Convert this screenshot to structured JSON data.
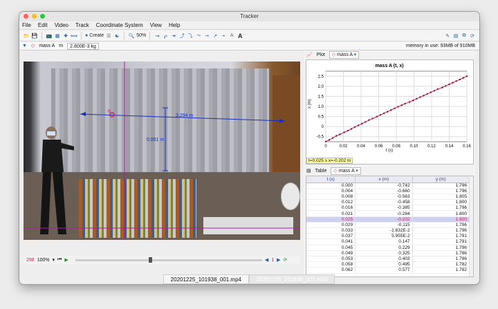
{
  "window": {
    "title": "Tracker"
  },
  "menu": [
    "File",
    "Edit",
    "Video",
    "Track",
    "Coordinate System",
    "View",
    "Help"
  ],
  "toolbar": {
    "create_label": "Create",
    "zoom_label": "50%",
    "font_label": "A"
  },
  "track_info": {
    "track_name": "mass A",
    "mass_label": "m",
    "mass_value": "2.800E-3 kg",
    "memory_label": "memory in use: 93MB of 910MB"
  },
  "video": {
    "distance_label": "3.294 m",
    "height_label": "0.951 m",
    "point_label": "6"
  },
  "player": {
    "frame": "298",
    "zoom": "100%"
  },
  "plot": {
    "tab_label": "Plot",
    "track_select": "mass A",
    "title": "mass A (t, x)",
    "xlabel": "t (s)",
    "ylabel": "x (m)",
    "readout": "t=0.025 s  x=-0.202 m",
    "x_ticks": [
      "0",
      "0.02",
      "0.04",
      "0.06",
      "0.08",
      "0.10",
      "0.12",
      "0.14",
      "0.16"
    ],
    "y_ticks": [
      "2.5",
      "2.0",
      "1.5",
      "1.0",
      "0.5",
      "0",
      "-0.5"
    ]
  },
  "chart_data": {
    "type": "line",
    "title": "mass A (t, x)",
    "xlabel": "t (s)",
    "ylabel": "x (m)",
    "xlim": [
      0,
      0.16
    ],
    "ylim": [
      -0.75,
      2.75
    ],
    "x": [
      0.0,
      0.004,
      0.008,
      0.012,
      0.016,
      0.021,
      0.025,
      0.029,
      0.033,
      0.037,
      0.041,
      0.045,
      0.049,
      0.053,
      0.058,
      0.062,
      0.066,
      0.07,
      0.074,
      0.078,
      0.082,
      0.086,
      0.09,
      0.095,
      0.099,
      0.103,
      0.107,
      0.111,
      0.115,
      0.119,
      0.123,
      0.127,
      0.132,
      0.136,
      0.14,
      0.144,
      0.148,
      0.152,
      0.156,
      0.16
    ],
    "y": [
      -0.742,
      -0.66,
      -0.563,
      -0.458,
      -0.385,
      -0.284,
      -0.202,
      -0.115,
      -0.018,
      0.06,
      0.147,
      0.229,
      0.325,
      0.403,
      0.495,
      0.577,
      0.66,
      0.74,
      0.82,
      0.905,
      0.985,
      1.06,
      1.14,
      1.22,
      1.3,
      1.385,
      1.46,
      1.54,
      1.62,
      1.7,
      1.78,
      1.86,
      1.94,
      2.02,
      2.1,
      2.18,
      2.26,
      2.34,
      2.42,
      2.5
    ]
  },
  "table": {
    "tab_label": "Table",
    "track_select": "mass A",
    "columns": [
      "t (s)",
      "x (m)",
      "y (m)"
    ],
    "rows": [
      [
        "0.000",
        "-0.742",
        "1.796"
      ],
      [
        "0.004",
        "-0.660",
        "1.796"
      ],
      [
        "0.008",
        "-0.563",
        "1.805"
      ],
      [
        "0.012",
        "-0.458",
        "1.800"
      ],
      [
        "0.016",
        "-0.385",
        "1.796"
      ],
      [
        "0.021",
        "-0.284",
        "1.800"
      ],
      [
        "0.025",
        "-0.202",
        "1.800"
      ],
      [
        "0.029",
        "-0.115",
        "1.796"
      ],
      [
        "0.033",
        "-1.832E-2",
        "1.796"
      ],
      [
        "0.037",
        "5.955E-2",
        "1.791"
      ],
      [
        "0.041",
        "0.147",
        "1.791"
      ],
      [
        "0.045",
        "0.229",
        "1.796"
      ],
      [
        "0.049",
        "0.325",
        "1.786"
      ],
      [
        "0.053",
        "0.403",
        "1.786"
      ],
      [
        "0.058",
        "0.495",
        "1.782"
      ],
      [
        "0.062",
        "0.577",
        "1.782"
      ]
    ],
    "selected_row": 6
  },
  "tabs": {
    "active": "20201225_101938_001.mp4",
    "inactive": "20201225_101938_001.mp4"
  },
  "colors": {
    "accent": "#1f5fa8",
    "track": "#cc2255",
    "axis": "#1a2fbf",
    "guide": "#b01a9e"
  }
}
